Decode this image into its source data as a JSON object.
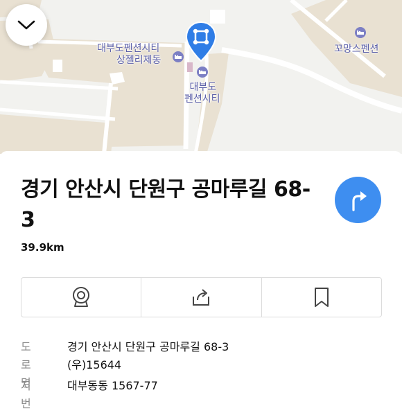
{
  "map": {
    "labels": {
      "pension_city_sangjelije": [
        "대부도펜션시티",
        "상젤리제동"
      ],
      "pension_city": [
        "대부도",
        "펜션시티"
      ],
      "ggomang": "꼬망스펜션"
    },
    "icons": {
      "collapse": "chevron-down-icon",
      "pin": "location-pin-icon",
      "poi": "lodging-icon"
    }
  },
  "place": {
    "title": "경기 안산시 단원구 공마루길 68-3",
    "distance": "39.9km"
  },
  "actions": [
    {
      "name": "roadview-button",
      "icon": "roadview-camera-icon"
    },
    {
      "name": "share-button",
      "icon": "share-icon"
    },
    {
      "name": "bookmark-button",
      "icon": "bookmark-icon"
    }
  ],
  "address": {
    "road_label": "도로명",
    "road_value": "경기 안산시 단원구 공마루길 68-3",
    "postal_value": "(우)15644",
    "lot_label": "지번",
    "lot_value": "대부동동 1567-77"
  },
  "colors": {
    "accent": "#3e8ef0",
    "pin": "#2f7de6",
    "map_bg": "#f2f2ef",
    "map_block": "#e9e1d2",
    "poi_label": "#5b5fa8"
  }
}
